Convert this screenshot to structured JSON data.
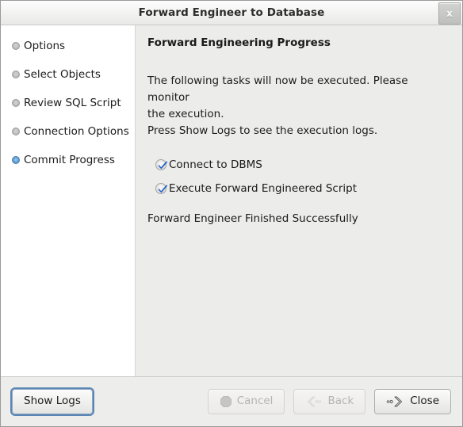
{
  "titlebar": {
    "title": "Forward Engineer to Database",
    "close_label": "x",
    "close_icon": "close-icon"
  },
  "sidebar": {
    "items": [
      {
        "label": "Options",
        "active": false
      },
      {
        "label": "Select Objects",
        "active": false
      },
      {
        "label": "Review SQL Script",
        "active": false
      },
      {
        "label": "Connection Options",
        "active": false
      },
      {
        "label": "Commit Progress",
        "active": true
      }
    ]
  },
  "content": {
    "heading": "Forward Engineering Progress",
    "intro_line1": "The following tasks will now be executed. Please monitor",
    "intro_line2": "the execution.",
    "intro_line3": "Press Show Logs to see the execution logs.",
    "tasks": [
      {
        "label": "Connect to DBMS",
        "checked": true
      },
      {
        "label": "Execute Forward Engineered Script",
        "checked": true
      }
    ],
    "status": "Forward Engineer Finished Successfully"
  },
  "footer": {
    "show_logs": "Show Logs",
    "cancel": "Cancel",
    "back": "Back",
    "close": "Close",
    "cancel_icon": "stop-octagon-icon",
    "back_icon": "chevron-left-icon",
    "close_icon": "chevron-right-icon"
  },
  "colors": {
    "accent_blue": "#3a7fc1",
    "check_blue": "#1a5fc8",
    "panel_gray": "#ececea",
    "sidebar_white": "#ffffff",
    "focus_ring": "#5a86b5"
  }
}
